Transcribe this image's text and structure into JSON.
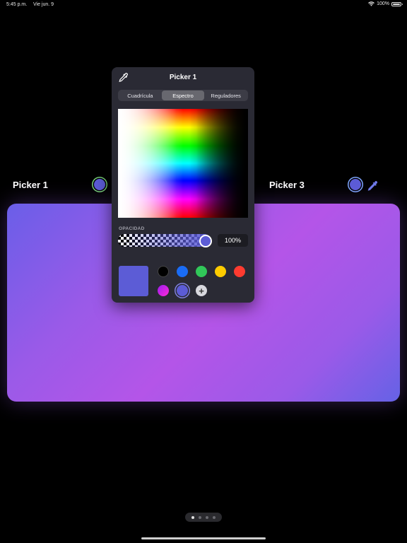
{
  "status_bar": {
    "time": "5:45 p.m.",
    "date": "Vie jun. 9",
    "battery": "100%",
    "icons": [
      "wifi-icon",
      "battery-icon"
    ]
  },
  "pickers": [
    {
      "label": "Picker 1",
      "color": "#5c5cd6"
    },
    {
      "label": "Picker 3",
      "color": "#5c5cd6"
    }
  ],
  "popover": {
    "title": "Picker 1",
    "tabs": [
      {
        "label": "Cuadrícula",
        "active": false
      },
      {
        "label": "Espectro",
        "active": true
      },
      {
        "label": "Reguladores",
        "active": false
      }
    ],
    "opacity_label": "OPACIDAD",
    "opacity_value": "100%",
    "selected_color": "#5c5cd6",
    "swatches": [
      "#000000",
      "#1a6cf5",
      "#31c759",
      "#ffcc00",
      "#ff3b30",
      "#d21cf0",
      "#5c5cd6"
    ],
    "add_label": "+"
  },
  "page_indicator": {
    "count": 4,
    "active_index": 0
  },
  "colors": {
    "accent": "#5c5cd6",
    "popover_bg": "#2a2a34",
    "gradient_start": "#6a5ee8",
    "gradient_mid": "#b455e8"
  }
}
